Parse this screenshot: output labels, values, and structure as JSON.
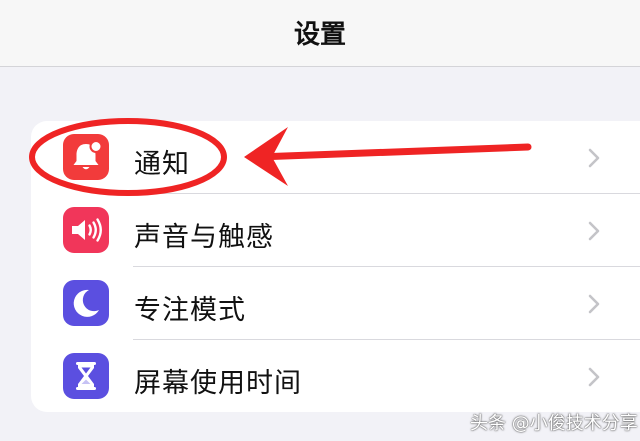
{
  "navbar": {
    "title": "设置"
  },
  "settings": {
    "items": [
      {
        "label": "通知",
        "icon": "notification-bell-icon",
        "icon_color": "#f23b3b"
      },
      {
        "label": "声音与触感",
        "icon": "speaker-icon",
        "icon_color": "#f1365a"
      },
      {
        "label": "专注模式",
        "icon": "moon-icon",
        "icon_color": "#5b4fe0"
      },
      {
        "label": "屏幕使用时间",
        "icon": "hourglass-icon",
        "icon_color": "#5b4fe0"
      }
    ]
  },
  "annotation": {
    "color": "#ef2424"
  },
  "watermark": {
    "text": "头条 @小俊技术分享"
  }
}
